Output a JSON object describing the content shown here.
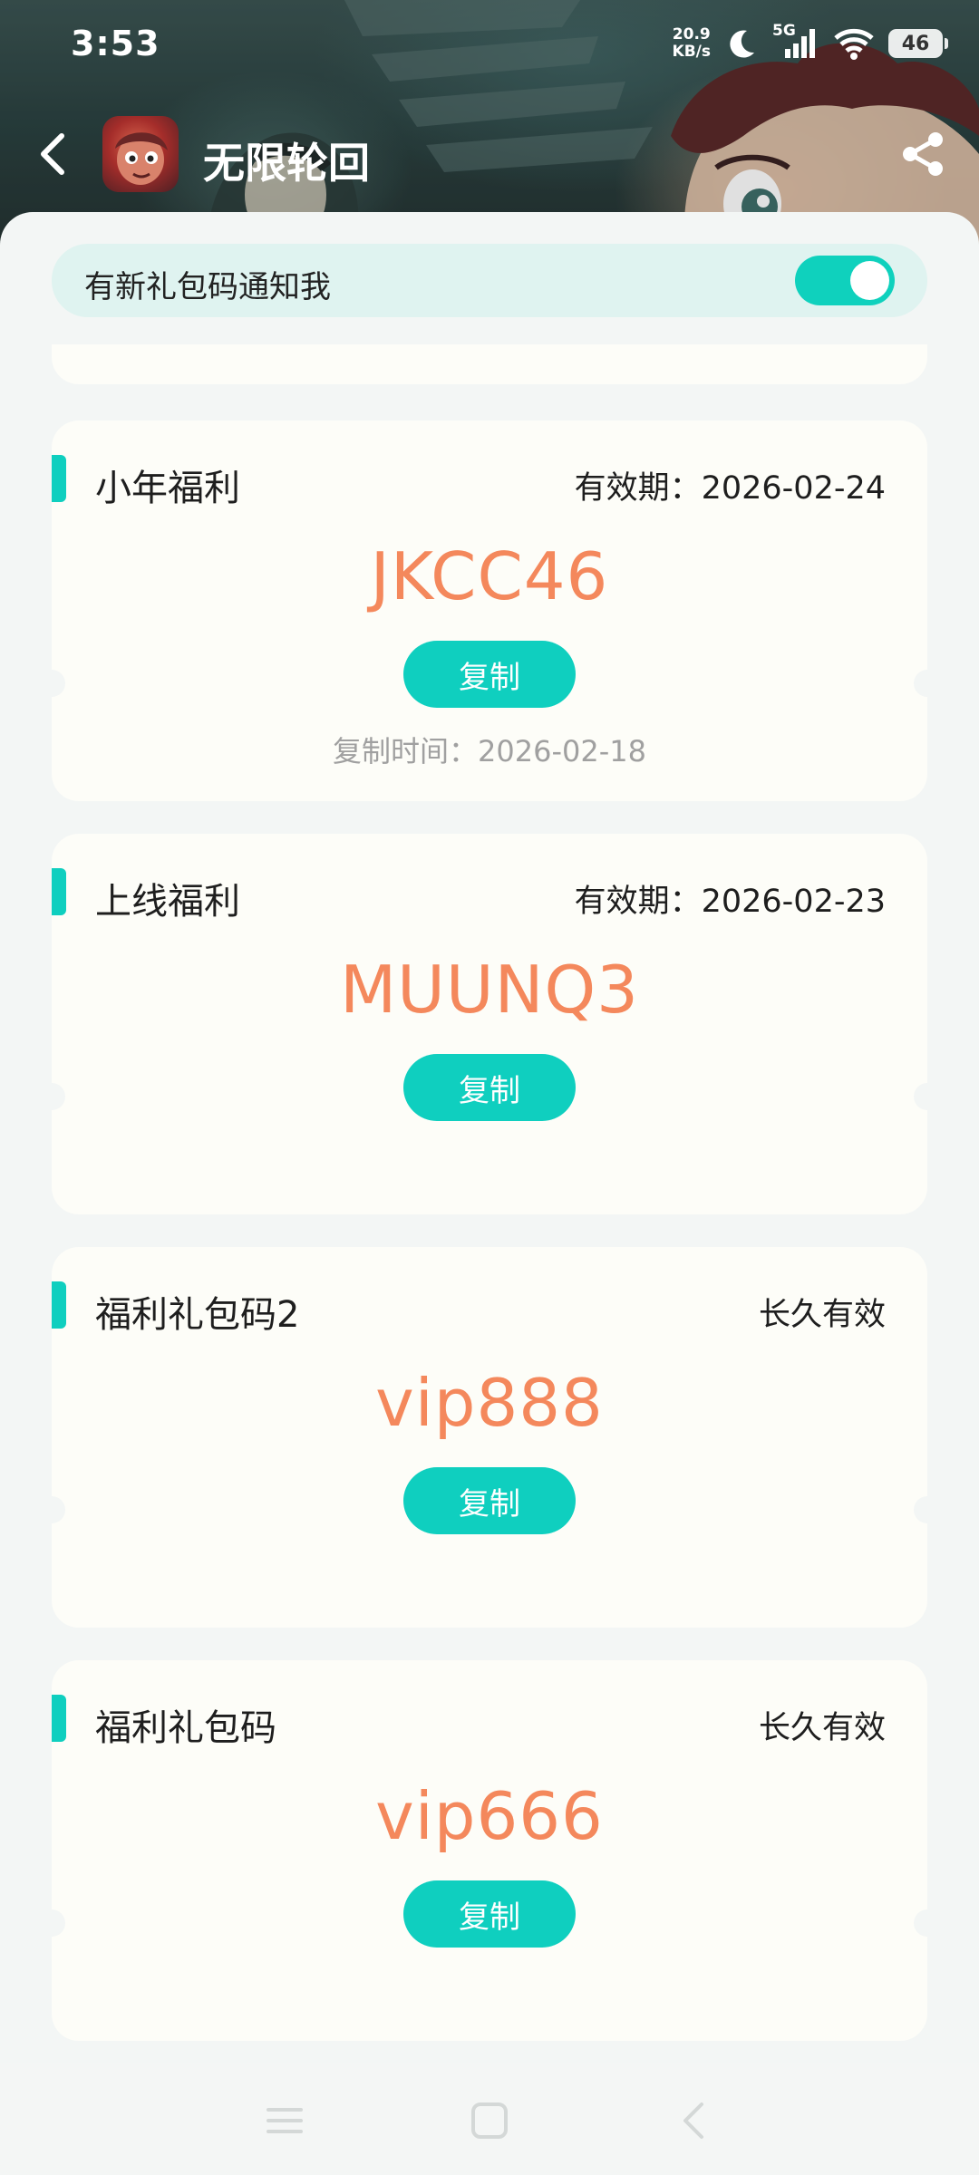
{
  "status_bar": {
    "time": "3:53",
    "net_speed_value": "20.9",
    "net_speed_unit": "KB/s",
    "network_type": "5G",
    "battery_level": "46",
    "icons": [
      "moon-icon",
      "signal-icon",
      "wifi-icon",
      "battery-icon"
    ]
  },
  "header": {
    "title": "无限轮回",
    "back_icon": "chevron-left-icon",
    "share_icon": "share-icon"
  },
  "notify": {
    "label": "有新礼包码通知我",
    "enabled": true
  },
  "codes": [
    {
      "title": "小年福利",
      "validity": "有效期：2026-02-24",
      "code": "JKCC46",
      "copy_label": "复制",
      "copy_time": "复制时间：2026-02-18"
    },
    {
      "title": "上线福利",
      "validity": "有效期：2026-02-23",
      "code": "MUUNQ3",
      "copy_label": "复制",
      "copy_time": ""
    },
    {
      "title": "福利礼包码2",
      "validity": "长久有效",
      "code": "vip888",
      "copy_label": "复制",
      "copy_time": ""
    },
    {
      "title": "福利礼包码",
      "validity": "长久有效",
      "code": "vip666",
      "copy_label": "复制",
      "copy_time": ""
    }
  ],
  "colors": {
    "accent": "#0fcfbf",
    "code_text": "#f4885c",
    "card_bg": "#fdfdf8",
    "notify_bg": "#dff3f0"
  },
  "nav_bar": {
    "icons": [
      "menu-icon",
      "home-icon",
      "back-icon"
    ]
  }
}
